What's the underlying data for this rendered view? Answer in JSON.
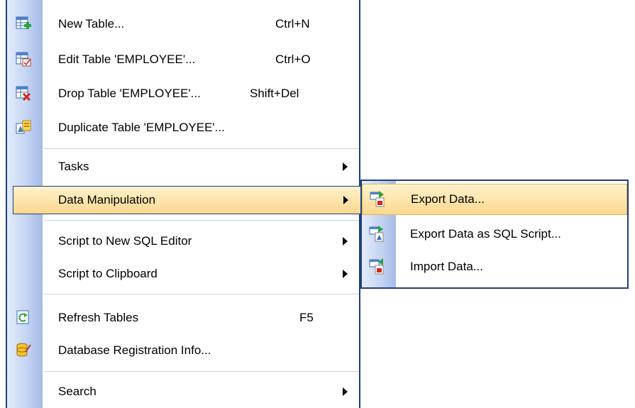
{
  "menu": {
    "items": [
      {
        "label": "New Table...",
        "shortcut": "Ctrl+N",
        "icon": "new-table-icon"
      },
      {
        "label": "Edit Table 'EMPLOYEE'...",
        "shortcut": "Ctrl+O",
        "icon": "edit-table-icon"
      },
      {
        "label": "Drop Table 'EMPLOYEE'...",
        "shortcut": "Shift+Del",
        "icon": "drop-table-icon"
      },
      {
        "label": "Duplicate Table 'EMPLOYEE'...",
        "icon": "duplicate-table-icon"
      },
      {
        "label": "Tasks",
        "submenu": true
      },
      {
        "label": "Data Manipulation",
        "submenu": true,
        "highlighted": true
      },
      {
        "label": "Script to New SQL Editor",
        "submenu": true
      },
      {
        "label": "Script to Clipboard",
        "submenu": true
      },
      {
        "label": "Refresh Tables",
        "shortcut": "F5",
        "icon": "refresh-icon"
      },
      {
        "label": "Database Registration Info...",
        "icon": "registration-info-icon"
      },
      {
        "label": "Search",
        "submenu": true
      }
    ]
  },
  "submenu": {
    "items": [
      {
        "label": "Export Data...",
        "icon": "export-data-icon",
        "highlighted": true
      },
      {
        "label": "Export Data as SQL Script...",
        "icon": "export-sql-script-icon"
      },
      {
        "label": "Import Data...",
        "icon": "import-data-icon"
      }
    ]
  },
  "colors": {
    "highlight_top": "#fff2cc",
    "highlight_bottom": "#fcd88f",
    "border": "#1f3f7f",
    "gutter": "#c4d4f3"
  }
}
